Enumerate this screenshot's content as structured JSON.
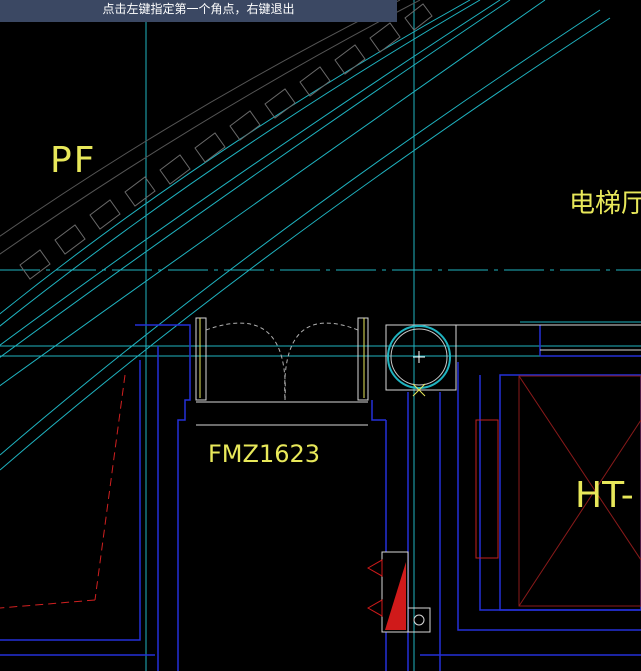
{
  "prompt": {
    "text": "点击左键指定第一个角点，右键退出"
  },
  "labels": {
    "pf": "PF",
    "elevator_hall": "电梯厅",
    "door_tag": "FMZ1623",
    "ht": "HT-"
  },
  "colors": {
    "background": "#000000",
    "cyan_line": "#1fb3c0",
    "blue_wall": "#2430d8",
    "white_line": "#d8d8d8",
    "yellow_text": "#e8e85a",
    "red_line": "#d02020",
    "prompt_bg": "#3b4863"
  },
  "icons": {
    "column": "circle-column-icon",
    "cursor": "crosshair-cursor-icon"
  }
}
